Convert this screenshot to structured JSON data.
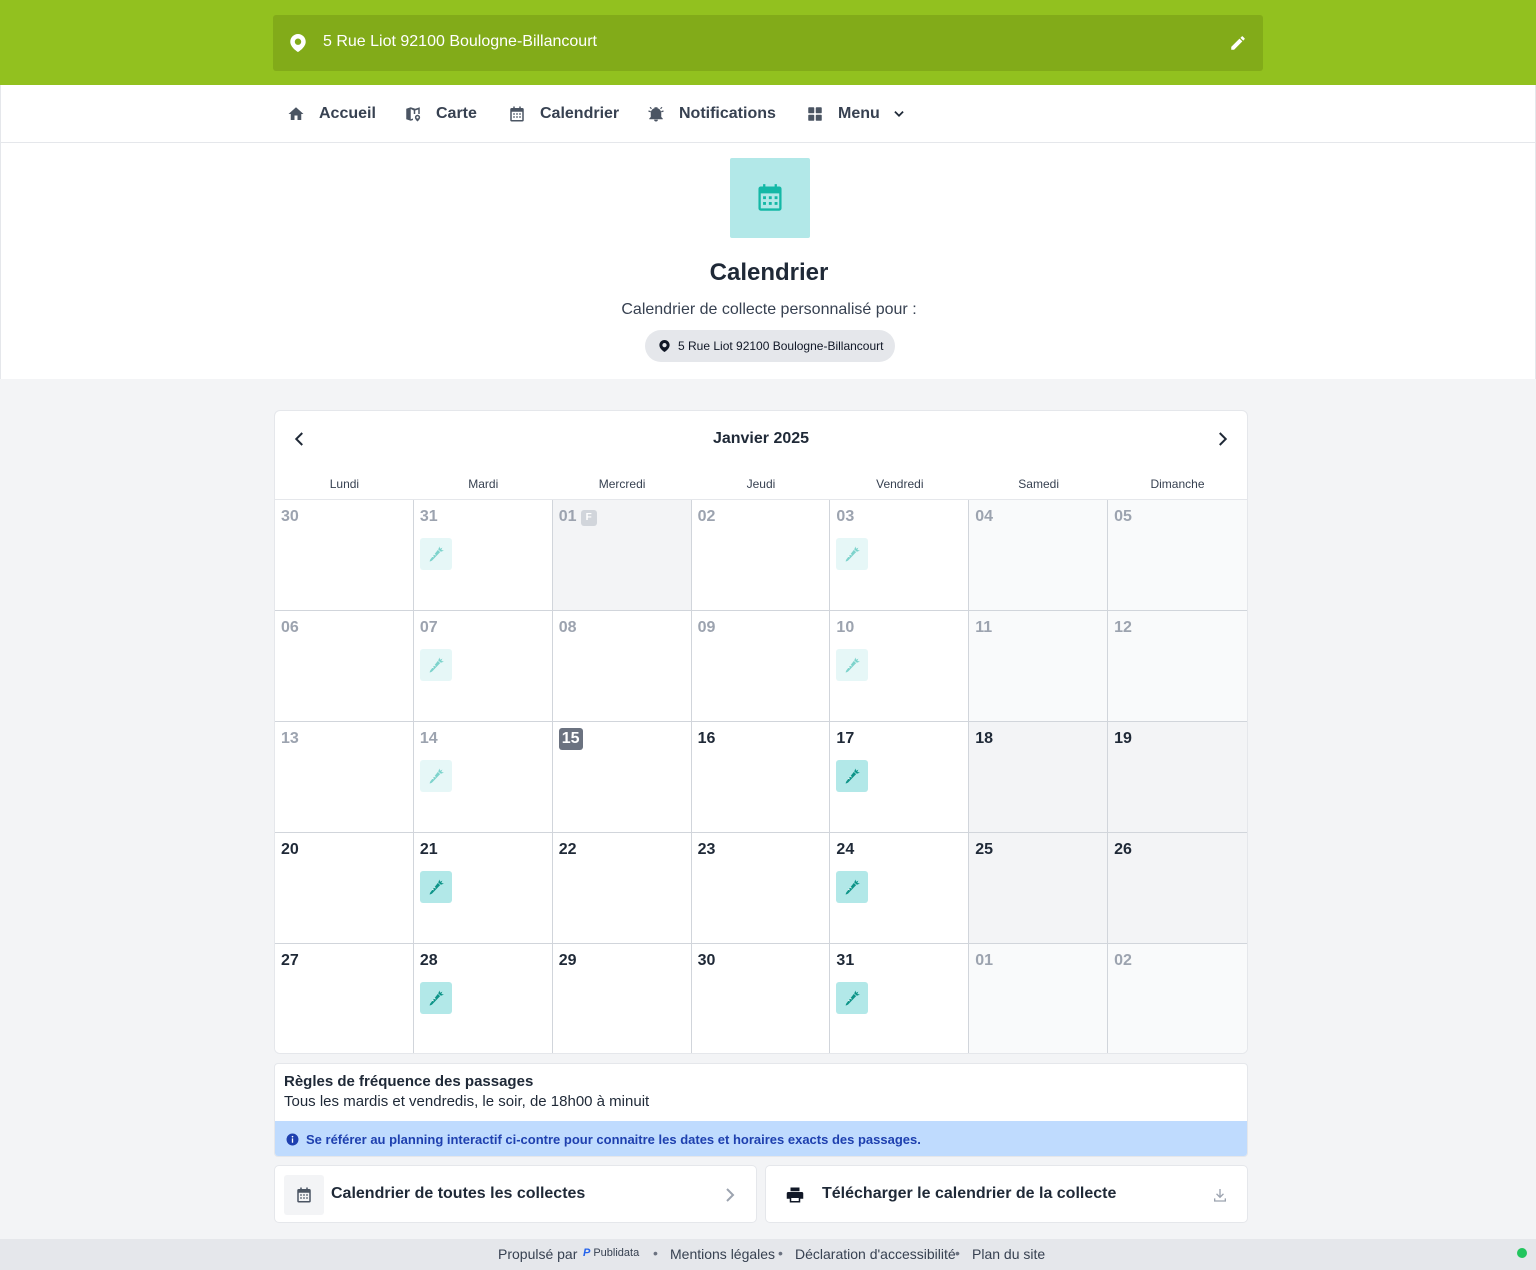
{
  "address": {
    "full": "5 Rue Liot 92100 Boulogne-Billancourt"
  },
  "nav": {
    "items": [
      {
        "label": "Accueil",
        "icon": "home-icon"
      },
      {
        "label": "Carte",
        "icon": "map-icon"
      },
      {
        "label": "Calendrier",
        "icon": "calendar-icon"
      },
      {
        "label": "Notifications",
        "icon": "bell-icon"
      },
      {
        "label": "Menu",
        "icon": "grid-icon"
      }
    ]
  },
  "hero": {
    "title": "Calendrier",
    "subtitle": "Calendrier de collecte personnalisé pour :",
    "chip": "5 Rue Liot 92100 Boulogne-Billancourt"
  },
  "calendar": {
    "month": "Janvier 2025",
    "weekdays": [
      "Lundi",
      "Mardi",
      "Mercredi",
      "Jeudi",
      "Vendredi",
      "Samedi",
      "Dimanche"
    ],
    "holiday_badge": "F",
    "days": [
      {
        "n": "30",
        "state": "past"
      },
      {
        "n": "31",
        "state": "past",
        "pickup": true
      },
      {
        "n": "01",
        "state": "holiday"
      },
      {
        "n": "02",
        "state": "past"
      },
      {
        "n": "03",
        "state": "past",
        "pickup": true
      },
      {
        "n": "04",
        "state": "past-we"
      },
      {
        "n": "05",
        "state": "past-we"
      },
      {
        "n": "06",
        "state": "past"
      },
      {
        "n": "07",
        "state": "past",
        "pickup": true
      },
      {
        "n": "08",
        "state": "past"
      },
      {
        "n": "09",
        "state": "past"
      },
      {
        "n": "10",
        "state": "past",
        "pickup": true
      },
      {
        "n": "11",
        "state": "past-we"
      },
      {
        "n": "12",
        "state": "past-we"
      },
      {
        "n": "13",
        "state": "past"
      },
      {
        "n": "14",
        "state": "past",
        "pickup": true
      },
      {
        "n": "15",
        "state": "today"
      },
      {
        "n": "16",
        "state": "active"
      },
      {
        "n": "17",
        "state": "active",
        "pickup": true
      },
      {
        "n": "18",
        "state": "weekend"
      },
      {
        "n": "19",
        "state": "weekend"
      },
      {
        "n": "20",
        "state": "active"
      },
      {
        "n": "21",
        "state": "active",
        "pickup": true
      },
      {
        "n": "22",
        "state": "active"
      },
      {
        "n": "23",
        "state": "active"
      },
      {
        "n": "24",
        "state": "active",
        "pickup": true
      },
      {
        "n": "25",
        "state": "weekend"
      },
      {
        "n": "26",
        "state": "weekend"
      },
      {
        "n": "27",
        "state": "active"
      },
      {
        "n": "28",
        "state": "active",
        "pickup": true
      },
      {
        "n": "29",
        "state": "active"
      },
      {
        "n": "30",
        "state": "active"
      },
      {
        "n": "31",
        "state": "active",
        "pickup": true
      },
      {
        "n": "01",
        "state": "past-we"
      },
      {
        "n": "02",
        "state": "past-we"
      }
    ]
  },
  "rules": {
    "title": "Règles de fréquence des passages",
    "text": "Tous les mardis et vendredis, le soir, de 18h00 à minuit",
    "info": "Se référer au planning interactif ci-contre pour connaitre les dates et horaires exacts des passages."
  },
  "cards": {
    "all_label": "Calendrier de toutes les collectes",
    "download_label": "Télécharger le calendrier de la collecte"
  },
  "footer": {
    "powered": "Propulsé par",
    "brand": "Publidata",
    "legal": "Mentions légales",
    "accessibility": "Déclaration d'accessibilité",
    "sitemap": "Plan du site",
    "separator": "•"
  },
  "colors": {
    "brand_green": "#92c11f",
    "teal": "#14b8a6",
    "teal_bg": "#b2e8e8"
  }
}
